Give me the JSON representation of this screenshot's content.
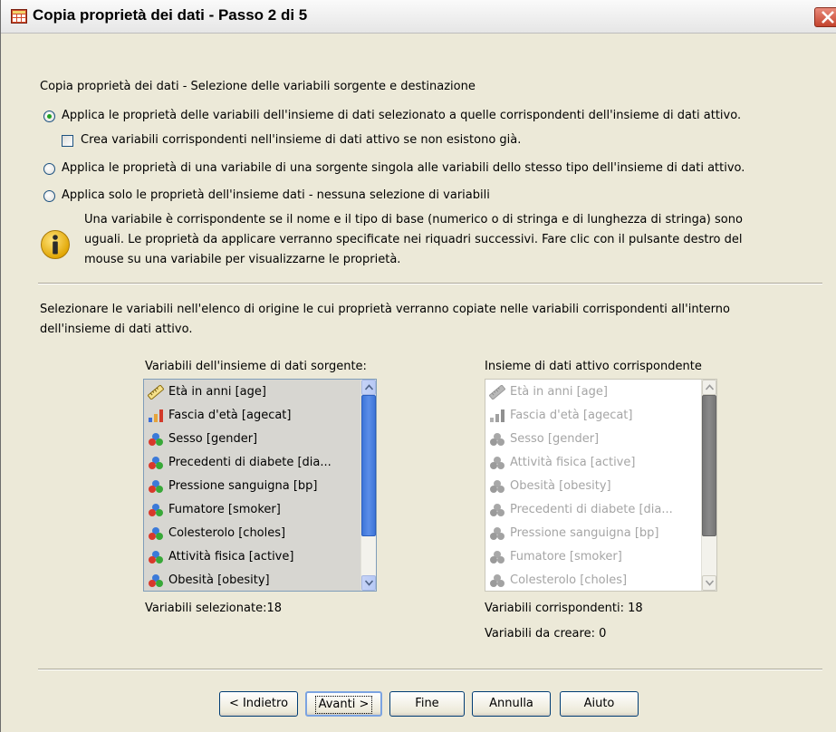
{
  "window": {
    "title": "Copia proprietà dei dati - Passo 2 di 5"
  },
  "section_heading": "Copia proprietà dei dati - Selezione delle variabili sorgente e destinazione",
  "options": {
    "apply_selected": "Applica le proprietà delle variabili dell'insieme di dati selezionato a quelle corrispondenti dell'insieme di dati attivo.",
    "create_matching": "Crea variabili corrispondenti nell'insieme di dati attivo se non esistono già.",
    "apply_single_source": "Applica le proprietà di una variabile di una sorgente singola alle variabili dello stesso tipo dell'insieme di dati attivo.",
    "apply_dataset_only": "Applica solo le proprietà dell'insieme dati -  nessuna selezione di variabili"
  },
  "info_lines": [
    "Una variabile è corrispondente se il nome e il tipo di  base (numerico o di stringa e di lunghezza di stringa) sono",
    "uguali. Le proprietà da applicare verranno specificate nei riquadri successivi. Fare clic con il pulsante destro del",
    "mouse su una variabile per visualizzarne le proprietà."
  ],
  "instruction_lines": [
    "Selezionare le variabili nell'elenco di origine le cui proprietà verranno copiate nelle variabili corrispondenti all'interno",
    "dell'insieme di dati attivo."
  ],
  "source_list": {
    "label": "Variabili dell'insieme di dati sorgente:",
    "items": [
      {
        "label": "Età in anni [age]",
        "icon": "scale-icon"
      },
      {
        "label": "Fascia d'età [agecat]",
        "icon": "ordinal-icon"
      },
      {
        "label": "Sesso [gender]",
        "icon": "nominal-icon"
      },
      {
        "label": "Precedenti di diabete [dia...",
        "icon": "nominal-icon"
      },
      {
        "label": "Pressione sanguigna [bp]",
        "icon": "nominal-icon"
      },
      {
        "label": "Fumatore [smoker]",
        "icon": "nominal-icon"
      },
      {
        "label": "Colesterolo [choles]",
        "icon": "nominal-icon"
      },
      {
        "label": "Attività fisica [active]",
        "icon": "nominal-icon"
      },
      {
        "label": "Obesità [obesity]",
        "icon": "nominal-icon"
      }
    ],
    "count_label": "Variabili selezionate:18"
  },
  "target_list": {
    "label": "Insieme di dati attivo corrispondente",
    "items": [
      {
        "label": "Età in anni [age]",
        "icon": "scale-icon"
      },
      {
        "label": "Fascia d'età [agecat]",
        "icon": "ordinal-icon"
      },
      {
        "label": "Sesso [gender]",
        "icon": "nominal-icon"
      },
      {
        "label": "Attività fisica [active]",
        "icon": "nominal-icon"
      },
      {
        "label": "Obesità [obesity]",
        "icon": "nominal-icon"
      },
      {
        "label": "Precedenti di diabete [dia...",
        "icon": "nominal-icon"
      },
      {
        "label": "Pressione sanguigna [bp]",
        "icon": "nominal-icon"
      },
      {
        "label": "Fumatore [smoker]",
        "icon": "nominal-icon"
      },
      {
        "label": "Colesterolo [choles]",
        "icon": "nominal-icon"
      }
    ],
    "matching_label": "Variabili corrispondenti: 18",
    "to_create_label": "Variabili da creare: 0"
  },
  "buttons": {
    "back": "< Indietro",
    "next": "Avanti >",
    "finish": "Fine",
    "cancel": "Annulla",
    "help": "Aiuto"
  },
  "colors": {
    "dialog_bg": "#ece9d8",
    "list_selected_bg": "#d7d6d1",
    "scroll_thumb": "#3e75d9",
    "radio_dot": "#21a121"
  }
}
